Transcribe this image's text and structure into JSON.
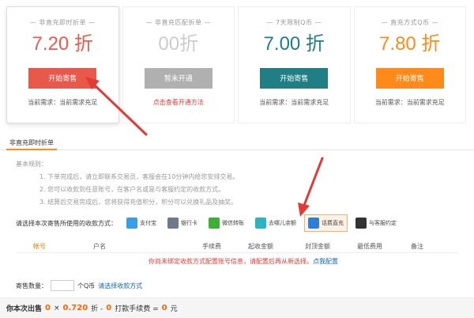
{
  "cards": [
    {
      "title": "— 非直充即时折单 —",
      "rate": "7.20 折",
      "rate_color": "#e95b4f",
      "button": "开始寄售",
      "button_color": "#e8594c",
      "demand": "当前需求：当前需求充足"
    },
    {
      "title": "— 非直充匹配折单 —",
      "rate": "00折",
      "rate_color": "#cccccc",
      "button": "暂未开通",
      "button_color": "#b0b0b0",
      "link": "点击查看开通方法"
    },
    {
      "title": "— 7天限制Q币 —",
      "rate": "7.00 折",
      "rate_color": "#1d7f86",
      "button": "开始寄售",
      "button_color": "#1f7f85",
      "demand": "当前需求：当前需求充足"
    },
    {
      "title": "— 直充方式Q币 —",
      "rate": "7.80 折",
      "rate_color": "#ff8a1a",
      "button": "开始寄售",
      "button_color": "#ff8a1a",
      "demand": "当前需求：当前需求充足"
    }
  ],
  "tab": {
    "label": "非直充即时折单"
  },
  "rules": {
    "heading": "基本规则：",
    "items": [
      "1. 下单完成后，请立即联系交易员，客服会在10分钟内给您安排交易。",
      "2. 您可以收款到任意账号，在客户名或是与客服约定的收款方式。",
      "3. 结算后交易完成后，您将获得充值积分，积分可以兑换礼品及抽奖。"
    ]
  },
  "payment": {
    "label": "请选择本次寄售所使用的收款方式：",
    "methods": [
      {
        "label": "支付宝",
        "icon": "alipay-icon",
        "color": "#3a9ee4"
      },
      {
        "label": "银行卡",
        "icon": "bank-card-icon",
        "color": "#6c7a89"
      },
      {
        "label": "微信转账",
        "icon": "wechat-icon",
        "color": "#3cb034"
      },
      {
        "label": "去哪儿余额",
        "icon": "wallet-icon",
        "color": "#2bb4c2"
      },
      {
        "label": "话费直充",
        "icon": "phone-recharge-icon",
        "color": "#2f7ed8",
        "selected": true
      },
      {
        "label": "与客服约定",
        "icon": "chat-icon",
        "color": "#333333"
      }
    ]
  },
  "table": {
    "columns": [
      "帐号",
      "户名",
      "手续费",
      "起收金额",
      "封顶金额",
      "最低费用",
      "备注"
    ],
    "empty_text": "你尚未绑定收款方式配置账号信息，请配置后再从新选择。",
    "empty_link": "点我配置"
  },
  "quantity": {
    "label": "寄售数量：",
    "value": "",
    "unit": "个Q币",
    "link": "请选择收款方式"
  },
  "summary": {
    "prefix": "你本次出售",
    "qty": "0",
    "times": "×",
    "rate": "0.720",
    "rate_unit": "折 -",
    "fee": "0",
    "fee_label": "打款手续费 =",
    "total": "0",
    "currency": "元"
  }
}
